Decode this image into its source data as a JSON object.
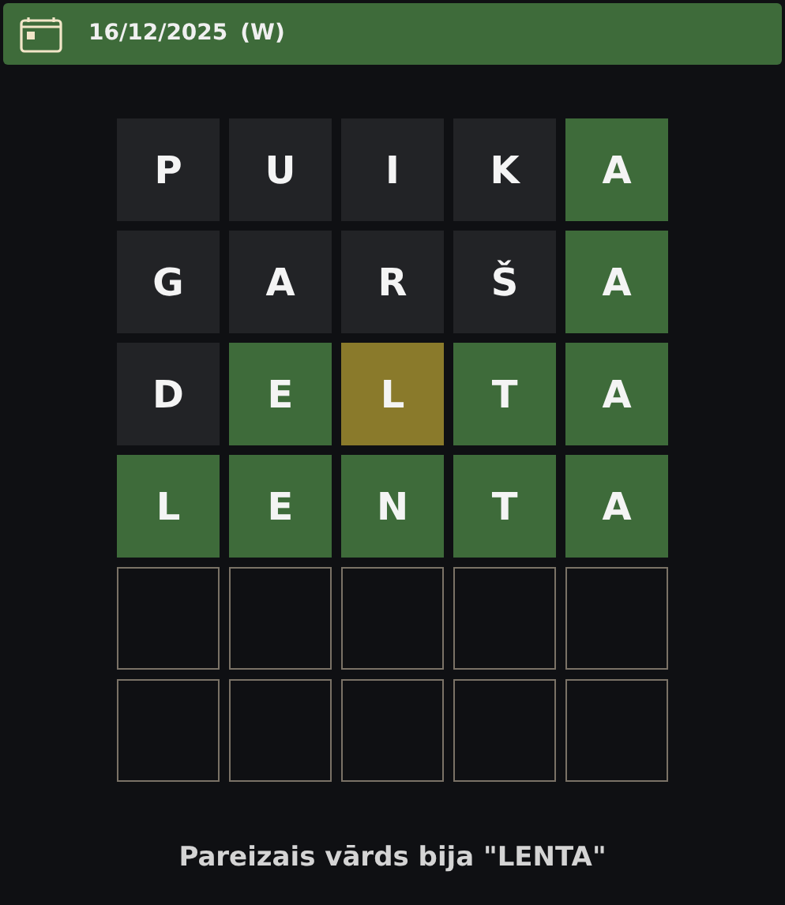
{
  "header": {
    "date": "16/12/2025",
    "mode": "(W)"
  },
  "rows": [
    [
      {
        "letter": "P",
        "kind": "absent"
      },
      {
        "letter": "U",
        "kind": "absent"
      },
      {
        "letter": "I",
        "kind": "absent"
      },
      {
        "letter": "K",
        "kind": "absent"
      },
      {
        "letter": "A",
        "kind": "correct"
      }
    ],
    [
      {
        "letter": "G",
        "kind": "absent"
      },
      {
        "letter": "A",
        "kind": "absent"
      },
      {
        "letter": "R",
        "kind": "absent"
      },
      {
        "letter": "Š",
        "kind": "absent"
      },
      {
        "letter": "A",
        "kind": "correct"
      }
    ],
    [
      {
        "letter": "D",
        "kind": "absent"
      },
      {
        "letter": "E",
        "kind": "correct"
      },
      {
        "letter": "L",
        "kind": "present"
      },
      {
        "letter": "T",
        "kind": "correct"
      },
      {
        "letter": "A",
        "kind": "correct"
      }
    ],
    [
      {
        "letter": "L",
        "kind": "correct"
      },
      {
        "letter": "E",
        "kind": "correct"
      },
      {
        "letter": "N",
        "kind": "correct"
      },
      {
        "letter": "T",
        "kind": "correct"
      },
      {
        "letter": "A",
        "kind": "correct"
      }
    ],
    [
      {
        "kind": "empty"
      },
      {
        "kind": "empty"
      },
      {
        "kind": "empty"
      },
      {
        "kind": "empty"
      },
      {
        "kind": "empty"
      }
    ],
    [
      {
        "kind": "empty"
      },
      {
        "kind": "empty"
      },
      {
        "kind": "empty"
      },
      {
        "kind": "empty"
      },
      {
        "kind": "empty"
      }
    ]
  ],
  "message": "Pareizais vārds bija \"LENTA\""
}
